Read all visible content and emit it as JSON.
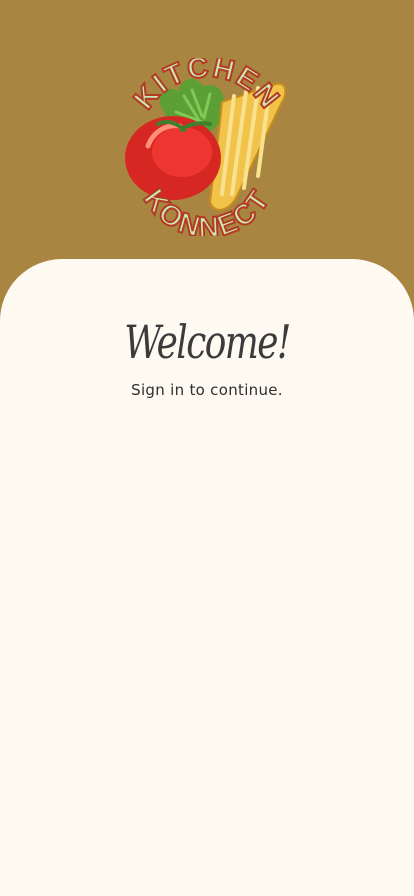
{
  "header": {
    "background_color": "#a88642",
    "logo": {
      "text_top": "KITCHEN",
      "text_bottom": "KONNECT",
      "accent_color": "#c9e8b3",
      "outline_color": "#b43a23"
    }
  },
  "sheet": {
    "background_color": "#fef9f1",
    "welcome_title": "Welcome!",
    "subtitle": "Sign in to continue."
  }
}
